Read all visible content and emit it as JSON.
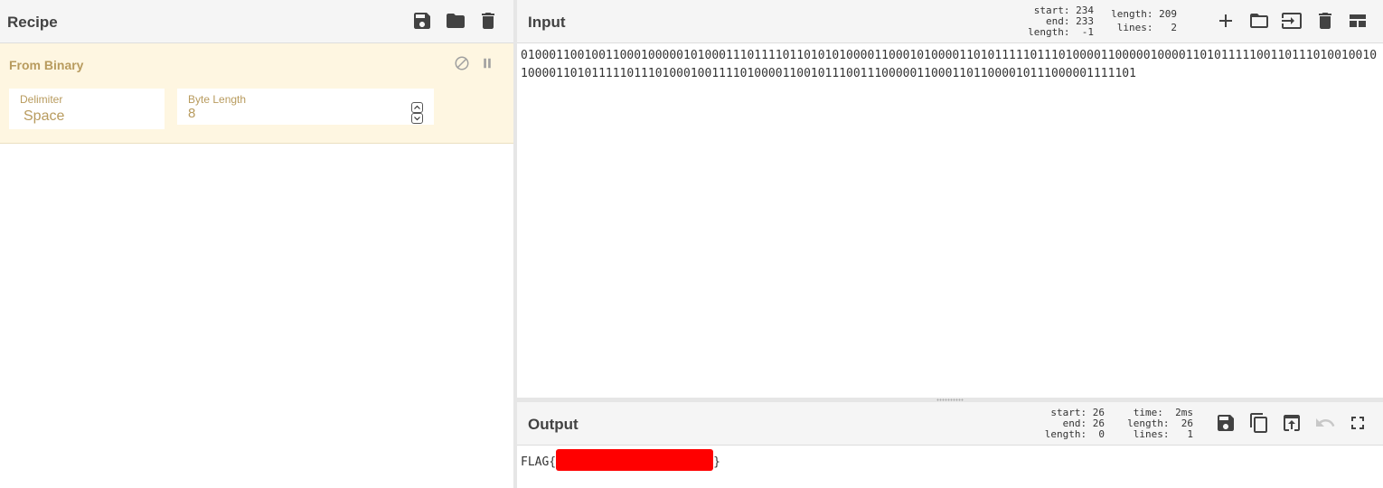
{
  "recipe": {
    "title": "Recipe",
    "icons": [
      "save-icon",
      "folder-icon",
      "trash-icon"
    ],
    "operation": {
      "name": "From Binary",
      "controls": [
        "disable-icon",
        "pause-icon"
      ],
      "args": {
        "delimiter": {
          "label": "Delimiter",
          "value": "Space"
        },
        "byte_length": {
          "label": "Byte Length",
          "value": "8"
        }
      }
    }
  },
  "input": {
    "title": "Input",
    "stats": {
      "start": "start: 234",
      "end": "end: 233",
      "sel_length": "length:  -1",
      "length": "length: 209",
      "lines": "lines:   2"
    },
    "icons": [
      "plus-icon",
      "folder-icon",
      "import-icon",
      "trash-icon",
      "layout-icon"
    ],
    "text": "0100011001001100010000010100011101111011010101000011000101000011010111110111010000110000010000110101111100110111010010010100001101011111011101000100111101000011001011100111000001100011011000010111000001111101"
  },
  "output": {
    "title": "Output",
    "stats": {
      "start": "start: 26",
      "end": "end: 26",
      "sel_length": "length:  0",
      "time": "time:  2ms",
      "length": "length:  26",
      "lines": "lines:   1"
    },
    "icons": [
      "save-icon",
      "copy-icon",
      "replace-input-icon",
      "undo-icon",
      "maximize-icon"
    ],
    "prefix": "FLAG{",
    "suffix": "}",
    "redaction_color": "#ff0000"
  },
  "colors": {
    "operation_bg": "#fef6e1",
    "operation_text": "#b89b5e",
    "header_bg": "#f5f5f5"
  }
}
